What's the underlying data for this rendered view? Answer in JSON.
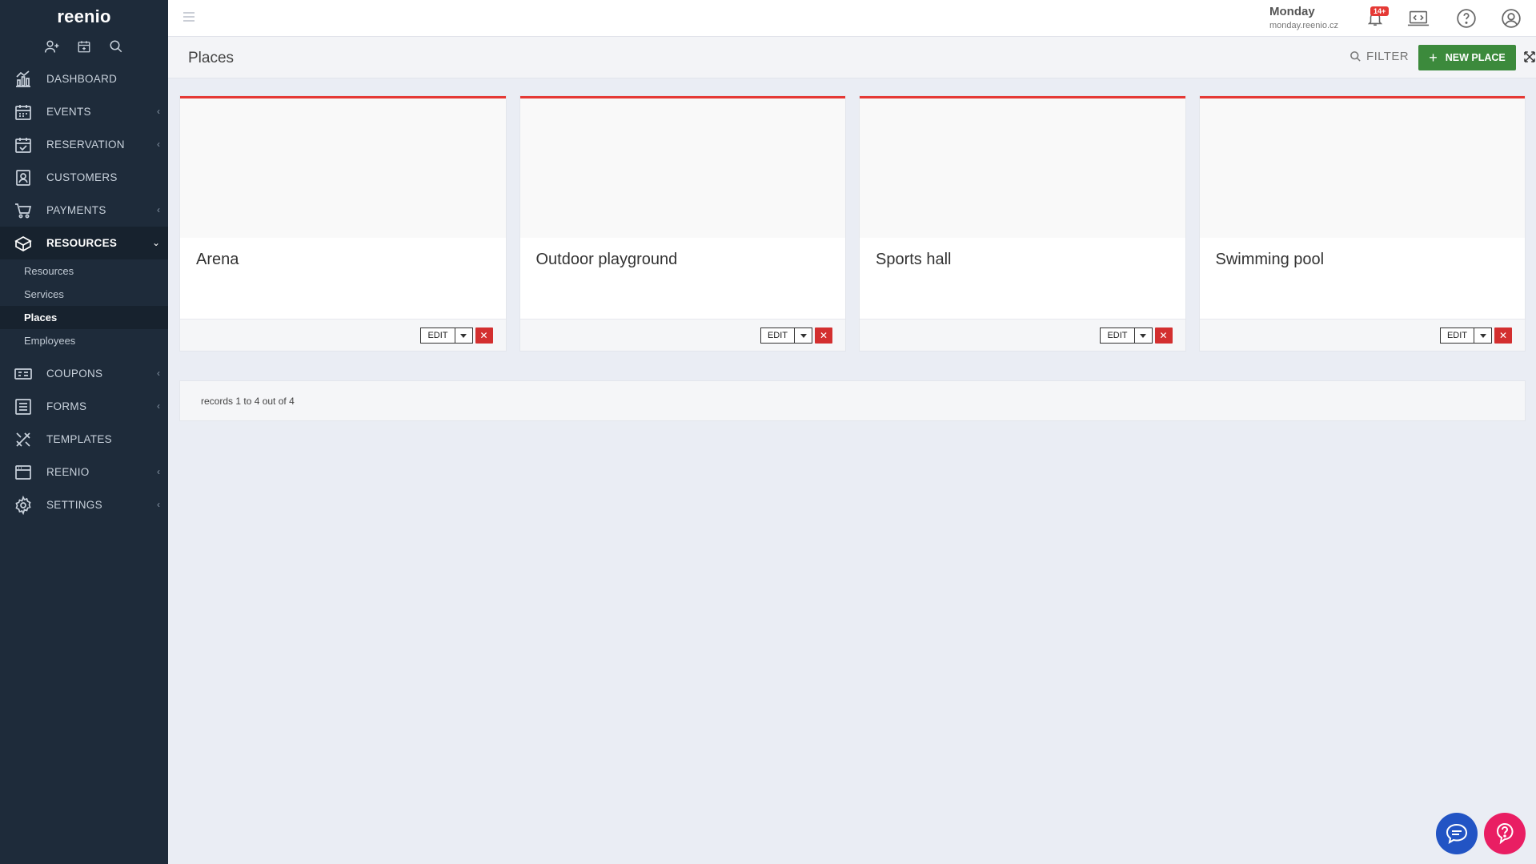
{
  "app": {
    "logo": "reenio"
  },
  "sidebar": {
    "nav": [
      {
        "label": "DASHBOARD",
        "icon": "dashboard-icon",
        "expandable": false
      },
      {
        "label": "EVENTS",
        "icon": "calendar-icon",
        "expandable": true
      },
      {
        "label": "RESERVATION",
        "icon": "calendar-check-icon",
        "expandable": true
      },
      {
        "label": "CUSTOMERS",
        "icon": "contacts-icon",
        "expandable": false
      },
      {
        "label": "PAYMENTS",
        "icon": "cart-icon",
        "expandable": true
      },
      {
        "label": "RESOURCES",
        "icon": "boxes-icon",
        "expandable": true,
        "active": true
      },
      {
        "label": "COUPONS",
        "icon": "coupon-icon",
        "expandable": true
      },
      {
        "label": "FORMS",
        "icon": "list-icon",
        "expandable": true
      },
      {
        "label": "TEMPLATES",
        "icon": "tools-icon",
        "expandable": false
      },
      {
        "label": "REENIO",
        "icon": "window-icon",
        "expandable": true
      },
      {
        "label": "SETTINGS",
        "icon": "gear-icon",
        "expandable": true
      }
    ],
    "resources_sub": [
      {
        "label": "Resources"
      },
      {
        "label": "Services"
      },
      {
        "label": "Places",
        "active": true
      },
      {
        "label": "Employees"
      }
    ]
  },
  "topbar": {
    "tenant_name": "Monday",
    "tenant_url": "monday.reenio.cz",
    "notifications_badge": "14+"
  },
  "header": {
    "title": "Places",
    "filter_label": "FILTER",
    "new_label": "NEW PLACE"
  },
  "places": [
    {
      "name": "Arena"
    },
    {
      "name": "Outdoor playground"
    },
    {
      "name": "Sports hall"
    },
    {
      "name": "Swimming pool"
    }
  ],
  "card_actions": {
    "edit_label": "EDIT",
    "delete_symbol": "✕"
  },
  "records_text": "records 1 to 4 out of 4",
  "colors": {
    "sidebar_bg": "#1e2b3a",
    "accent_red": "#e53935",
    "new_button_green": "#3c8a3c",
    "chat_blue": "#2254c4",
    "help_pink": "#e91e63"
  }
}
